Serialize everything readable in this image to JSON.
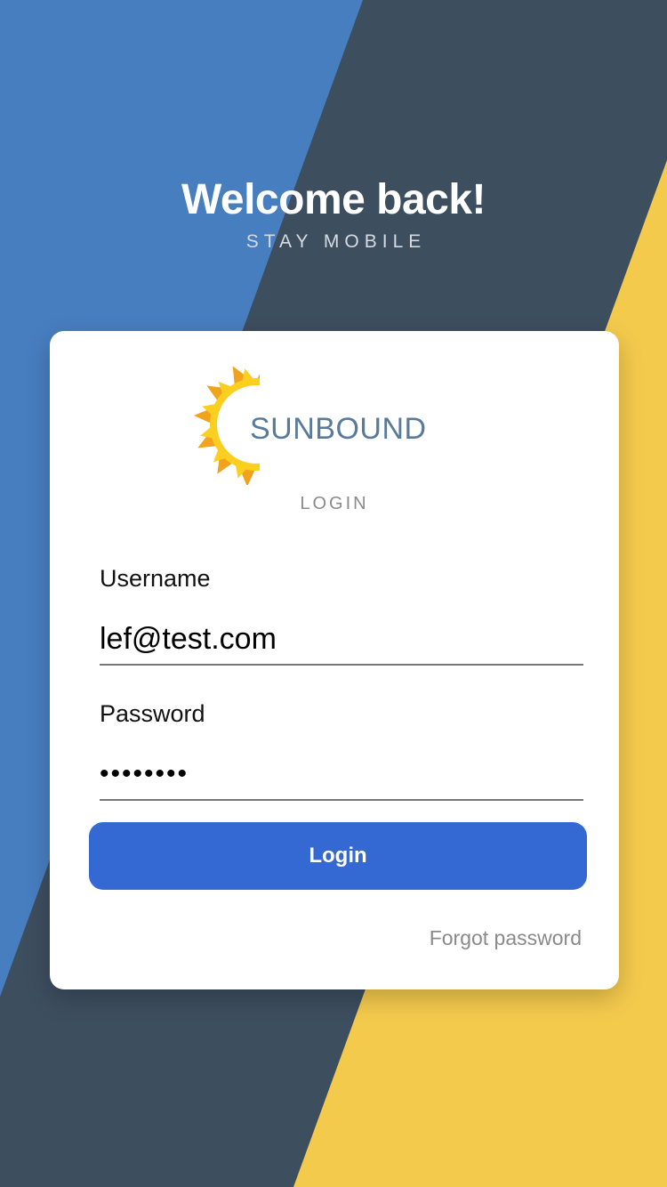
{
  "colors": {
    "background_dark": "#3d4e5f",
    "stripe_blue": "#477ec0",
    "stripe_yellow": "#f4ca4d",
    "button_blue": "#3468d2",
    "logo_text": "#5a7a9a",
    "sun_yellow": "#fbcf1f",
    "sun_orange": "#f2a31d"
  },
  "header": {
    "title": "Welcome back!",
    "subtitle": "STAY MOBILE"
  },
  "card": {
    "logo": {
      "icon": "sun-icon",
      "text": "SUNBOUND"
    },
    "caption": "LOGIN",
    "username": {
      "label": "Username",
      "value": "lef@test.com"
    },
    "password": {
      "label": "Password",
      "value": "••••••••"
    },
    "login_button_label": "Login",
    "forgot_password_label": "Forgot password"
  }
}
